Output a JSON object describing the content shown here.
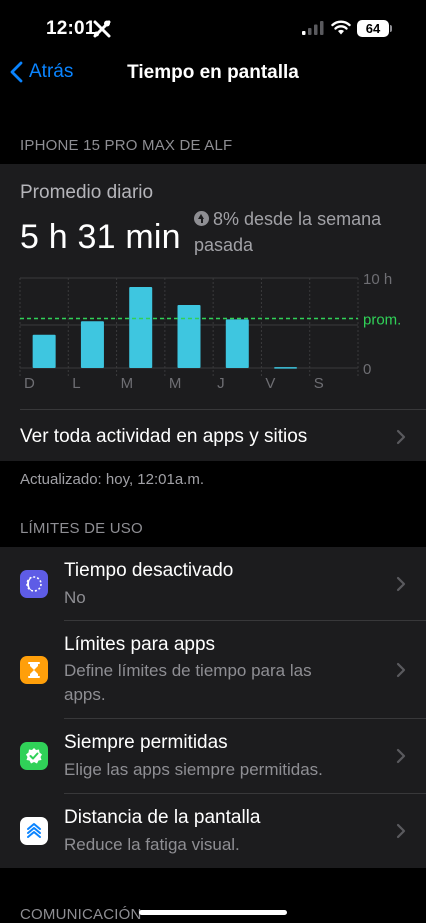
{
  "status_bar": {
    "time": "12:01",
    "battery": "64"
  },
  "nav": {
    "back_label": "Atrás",
    "title": "Tiempo en pantalla"
  },
  "device_section": {
    "header": "IPHONE 15 PRO MAX DE ALF"
  },
  "daily_average": {
    "label": "Promedio diario",
    "value": "5 h 31 min",
    "trend_line1": "8% desde la semana",
    "trend_line2": "pasada"
  },
  "chart_data": {
    "type": "bar",
    "categories": [
      "D",
      "L",
      "M",
      "M",
      "J",
      "V",
      "S"
    ],
    "values": [
      3.7,
      5.2,
      9.0,
      7.0,
      5.4,
      0.1,
      0
    ],
    "average": 5.5,
    "average_label": "prom.",
    "ylim": [
      0,
      10
    ],
    "ytick_labels": [
      "10 h",
      "0"
    ],
    "bar_color": "#3ec6e0",
    "average_color": "#30d158"
  },
  "activity_link": {
    "label": "Ver toda actividad en apps y sitios"
  },
  "updated": {
    "text": "Actualizado: hoy, 12:01a.m."
  },
  "limits_section": {
    "header": "LÍMITES DE USO",
    "items": [
      {
        "title": "Tiempo desactivado",
        "subtitle": "No",
        "icon": "downtime-icon",
        "color": "#5e5ce6"
      },
      {
        "title": "Límites para apps",
        "subtitle": "Define límites de tiempo para las apps.",
        "icon": "hourglass-icon",
        "color": "#ff9f0a"
      },
      {
        "title": "Siempre permitidas",
        "subtitle": "Elige las apps siempre permitidas.",
        "icon": "checkmark-badge-icon",
        "color": "#30d158"
      },
      {
        "title": "Distancia de la pantalla",
        "subtitle": "Reduce la fatiga visual.",
        "icon": "chevrons-up-icon",
        "color": "#ffffff"
      }
    ]
  },
  "communication_section": {
    "header": "COMUNICACIÓN"
  }
}
